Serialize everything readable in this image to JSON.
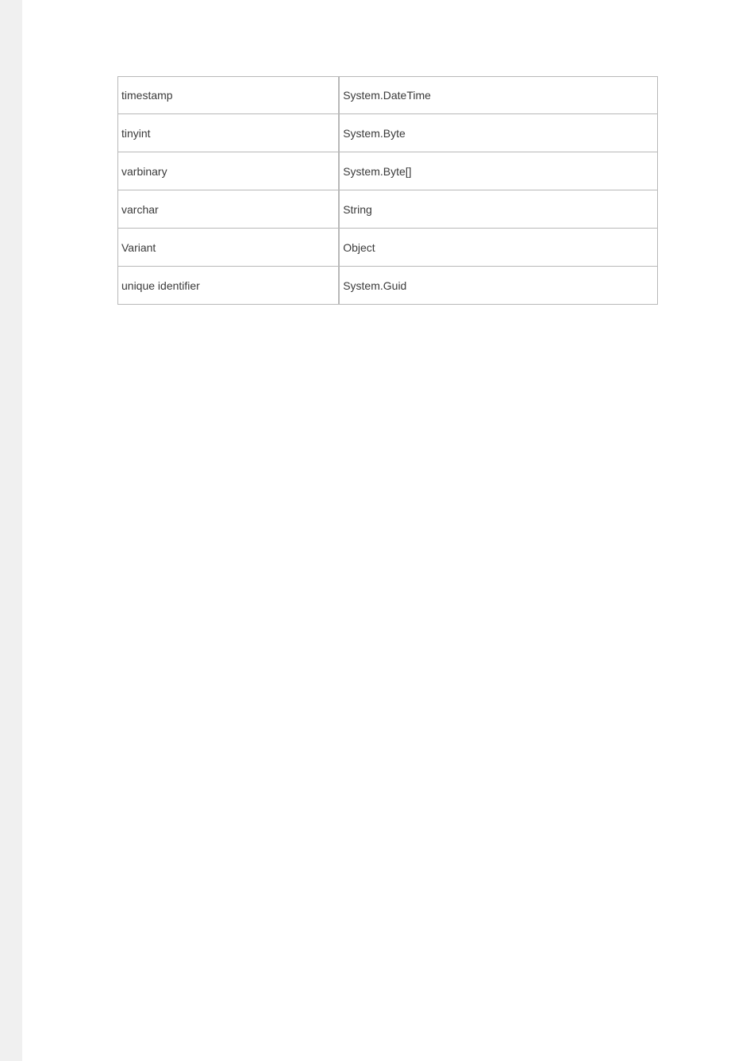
{
  "table": {
    "rows": [
      {
        "sql_type": "timestamp",
        "dotnet_type": "System.DateTime"
      },
      {
        "sql_type": "tinyint",
        "dotnet_type": "System.Byte"
      },
      {
        "sql_type": "varbinary",
        "dotnet_type": "System.Byte[]"
      },
      {
        "sql_type": "varchar",
        "dotnet_type": "String"
      },
      {
        "sql_type": "Variant",
        "dotnet_type": "Object"
      },
      {
        "sql_type": "unique  identifier",
        "dotnet_type": "System.Guid"
      }
    ]
  }
}
